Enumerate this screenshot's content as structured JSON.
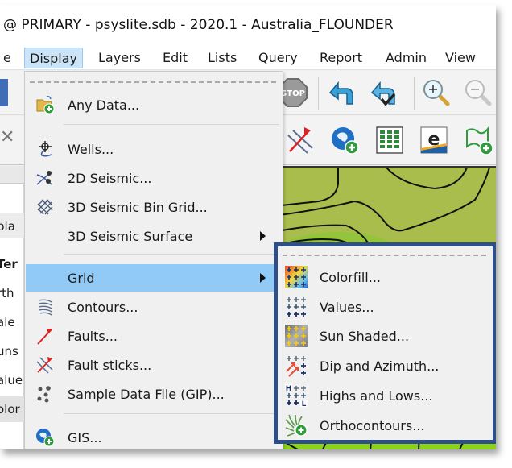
{
  "window": {
    "title": "@ PRIMARY - psyslite.sdb - 2020.1 - Australia_FLOUNDER"
  },
  "menubar": {
    "items": [
      {
        "label": "e"
      },
      {
        "label": "Display",
        "active": true
      },
      {
        "label": "Layers"
      },
      {
        "label": "Edit"
      },
      {
        "label": "Lists"
      },
      {
        "label": "Query"
      },
      {
        "label": "Report"
      },
      {
        "label": "Admin"
      },
      {
        "label": "View"
      }
    ]
  },
  "toolbar1": {
    "icons": [
      "stop-icon",
      "undo-icon",
      "undo-checked-icon",
      "zoom-in-icon",
      "zoom-out-icon"
    ]
  },
  "toolbar2": {
    "icons": [
      "fault-sticks-icon",
      "gis-add-icon",
      "spreadsheet-icon",
      "e-logo-icon",
      "polygon-add-icon"
    ]
  },
  "left_panel": {
    "rows": [
      {
        "text": "pla"
      },
      {
        "text": "Ter",
        "bold": true
      },
      {
        "text": "rth"
      },
      {
        "text": "ale"
      },
      {
        "text": "uns"
      },
      {
        "text": "alue"
      },
      {
        "text": "olor"
      }
    ]
  },
  "display_menu": {
    "items": [
      {
        "label": "Any Data...",
        "icon": "folder-add-icon"
      },
      {
        "label": "Wells...",
        "icon": "well-icon"
      },
      {
        "label": "2D Seismic...",
        "icon": "seismic-2d-icon"
      },
      {
        "label": "3D Seismic Bin Grid...",
        "icon": "bin-grid-icon"
      },
      {
        "label": "3D Seismic Surface",
        "icon": "",
        "submenu": true
      },
      {
        "label": "Grid",
        "icon": "",
        "submenu": true,
        "highlighted": true
      },
      {
        "label": "Contours...",
        "icon": "contours-icon"
      },
      {
        "label": "Faults...",
        "icon": "faults-icon"
      },
      {
        "label": "Fault sticks...",
        "icon": "fault-sticks-icon"
      },
      {
        "label": "Sample Data File (GIP)...",
        "icon": "sample-data-icon"
      },
      {
        "label": "GIS...",
        "icon": "gis-icon"
      }
    ]
  },
  "grid_submenu": {
    "items": [
      {
        "label": "Colorfill...",
        "icon": "colorfill-icon"
      },
      {
        "label": "Values...",
        "icon": "values-icon"
      },
      {
        "label": "Sun Shaded...",
        "icon": "sun-shaded-icon"
      },
      {
        "label": "Dip and Azimuth...",
        "icon": "dip-azimuth-icon"
      },
      {
        "label": "Highs and Lows...",
        "icon": "highs-lows-icon"
      },
      {
        "label": "Orthocontours...",
        "icon": "orthocontours-icon"
      }
    ]
  },
  "colors": {
    "menu_highlight": "#91c9f7",
    "menubar_active": "#cce4f7",
    "submenu_border": "#2f4f8a",
    "map_fill": "#a8bf48"
  }
}
